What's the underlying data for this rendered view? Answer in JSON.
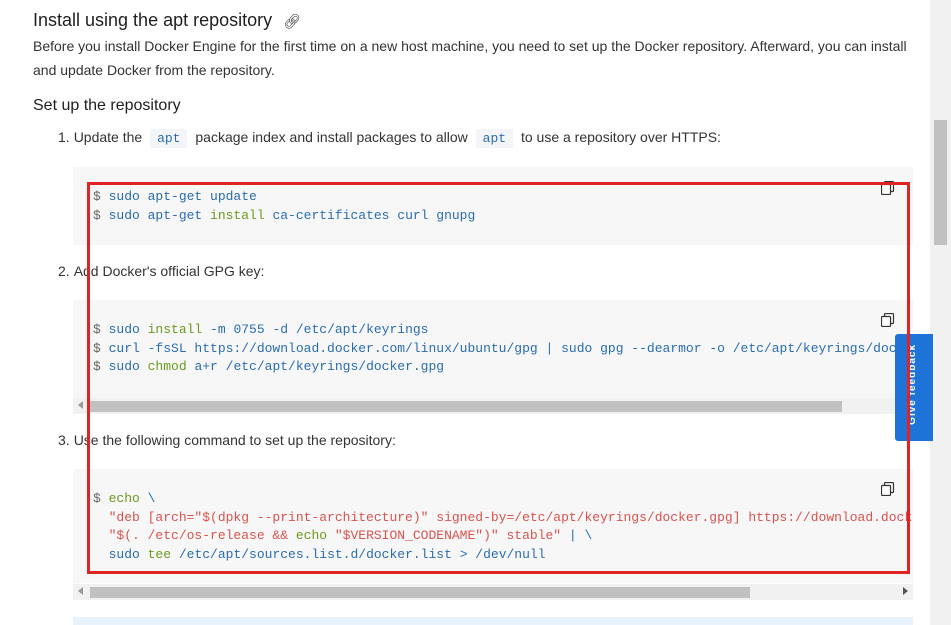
{
  "heading": "Install using the apt repository",
  "intro": "Before you install Docker Engine for the first time on a new host machine, you need to set up the Docker repository. Afterward, you can install and update Docker from the repository.",
  "subheading": "Set up the repository",
  "steps": [
    {
      "num": "1.",
      "text_before": "Update the",
      "code1": "apt",
      "text_mid": "package index and install packages to allow",
      "code2": "apt",
      "text_after": "to use a repository over HTTPS:"
    },
    {
      "num": "2.",
      "text": "Add Docker's official GPG key:"
    },
    {
      "num": "3.",
      "text": "Use the following command to set up the repository:"
    }
  ],
  "blocks": [
    {
      "lines": [
        [
          [
            "prompt",
            "$ "
          ],
          [
            "kw",
            "sudo apt-get update"
          ]
        ],
        [
          [
            "prompt",
            "$ "
          ],
          [
            "kw",
            "sudo apt-get "
          ],
          [
            "arg",
            "install "
          ],
          [
            "kw",
            "ca-certificates curl gnupg"
          ]
        ]
      ]
    },
    {
      "lines": [
        [
          [
            "prompt",
            "$ "
          ],
          [
            "kw",
            "sudo "
          ],
          [
            "arg",
            "install "
          ],
          [
            "kw",
            "-m 0755 -d /etc/apt/keyrings"
          ]
        ],
        [
          [
            "prompt",
            "$ "
          ],
          [
            "kw",
            "curl -fsSL https://download.docker.com/linux/ubuntu/gpg "
          ],
          [
            "pipe",
            "| "
          ],
          [
            "kw",
            "sudo gpg --dearmor -o /etc/apt/keyrings/doc"
          ]
        ],
        [
          [
            "prompt",
            "$ "
          ],
          [
            "kw",
            "sudo "
          ],
          [
            "arg",
            "chmod "
          ],
          [
            "kw",
            "a+r /etc/apt/keyrings/docker.gpg"
          ]
        ]
      ]
    },
    {
      "lines": [
        [
          [
            "prompt",
            "$ "
          ],
          [
            "arg",
            "echo "
          ],
          [
            "kw",
            "\\"
          ]
        ],
        [
          [
            "prompt",
            "  "
          ],
          [
            "str",
            "\"deb [arch=\"$(dpkg --print-architecture)\" signed-by=/etc/apt/keyrings/docker.gpg] https://download.dock"
          ]
        ],
        [
          [
            "prompt",
            "  "
          ],
          [
            "str",
            "\"$(. /etc/os-release && "
          ],
          [
            "arg",
            "echo "
          ],
          [
            "str",
            "\"$VERSION_CODENAME\")\" stable\" "
          ],
          [
            "pipe",
            "| "
          ],
          [
            "kw",
            "\\"
          ]
        ],
        [
          [
            "prompt",
            "  "
          ],
          [
            "kw",
            "sudo "
          ],
          [
            "arg",
            "tee "
          ],
          [
            "kw",
            "/etc/apt/sources.list.d/docker.list > /dev/null"
          ]
        ]
      ]
    }
  ],
  "feedback_label": "Give feedback",
  "colors": {
    "highlight_box": "#e02424",
    "feedback_bg": "#1d73d8"
  },
  "icons": {
    "copy": "copy-icon",
    "link": "link-icon"
  }
}
